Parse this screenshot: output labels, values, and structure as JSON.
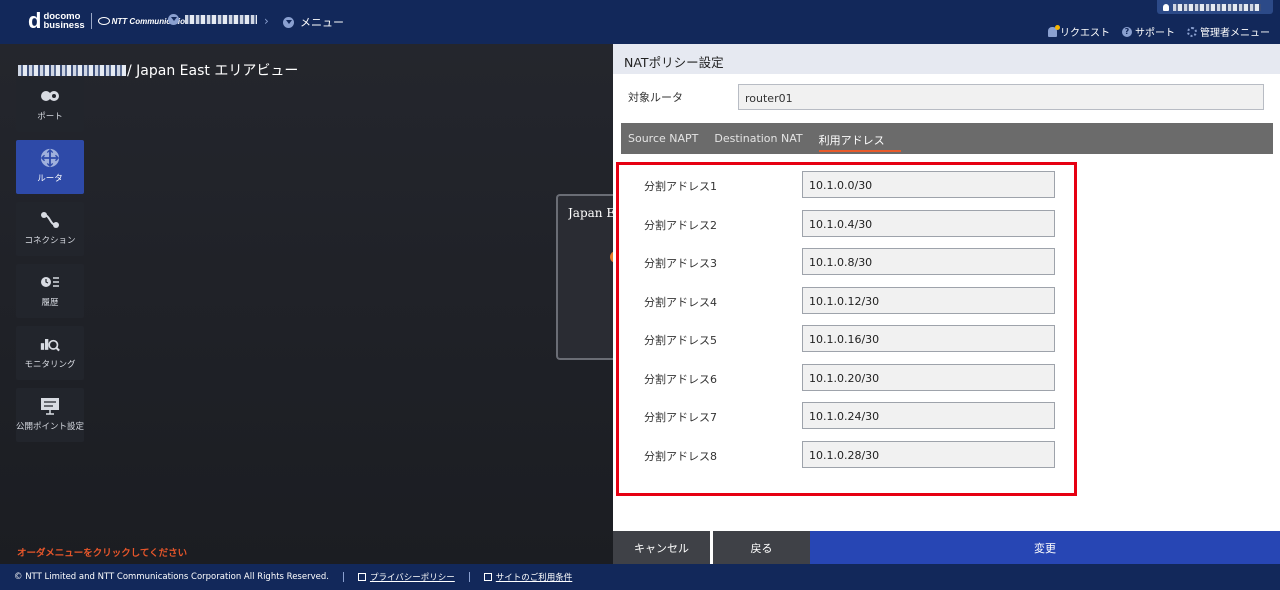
{
  "header": {
    "logo_main": "docomo",
    "logo_sub": "business",
    "ntt_logo": "NTT Communications",
    "breadcrumb_menu": "メニュー",
    "links": [
      {
        "label": "リクエスト",
        "icon": "bell-icon"
      },
      {
        "label": "サポート",
        "icon": "help-icon"
      },
      {
        "label": "管理者メニュー",
        "icon": "gear-icon"
      }
    ]
  },
  "area": {
    "title_suffix": "/ Japan East エリアビュー",
    "map_card_label": "Japan East",
    "order_hint": "オーダメニューをクリックしてください"
  },
  "sidenav": {
    "items": [
      {
        "label": "ポート",
        "icon": "port-icon",
        "active": false
      },
      {
        "label": "ルータ",
        "icon": "router-icon",
        "active": true
      },
      {
        "label": "コネクション",
        "icon": "connection-icon",
        "active": false
      },
      {
        "label": "履歴",
        "icon": "history-icon",
        "active": false
      },
      {
        "label": "モニタリング",
        "icon": "monitoring-icon",
        "active": false
      },
      {
        "label": "公開ポイント設定",
        "icon": "public-point-icon",
        "active": false
      }
    ]
  },
  "panel": {
    "title": "NATポリシー設定",
    "target_label": "対象ルータ",
    "target_value": "router01",
    "tabs": [
      "Source NAPT",
      "Destination NAT",
      "利用アドレス"
    ],
    "active_tab": "利用アドレス",
    "split_addresses": [
      {
        "label": "分割アドレス1",
        "value": "10.1.0.0/30"
      },
      {
        "label": "分割アドレス2",
        "value": "10.1.0.4/30"
      },
      {
        "label": "分割アドレス3",
        "value": "10.1.0.8/30"
      },
      {
        "label": "分割アドレス4",
        "value": "10.1.0.12/30"
      },
      {
        "label": "分割アドレス5",
        "value": "10.1.0.16/30"
      },
      {
        "label": "分割アドレス6",
        "value": "10.1.0.20/30"
      },
      {
        "label": "分割アドレス7",
        "value": "10.1.0.24/30"
      },
      {
        "label": "分割アドレス8",
        "value": "10.1.0.28/30"
      }
    ],
    "buttons": {
      "cancel": "キャンセル",
      "back": "戻る",
      "change": "変更"
    }
  },
  "footer": {
    "copyright": "© NTT Limited and NTT Communications Corporation All Rights Reserved.",
    "privacy": "プライバシーポリシー",
    "terms": "サイトのご利用条件"
  },
  "colors": {
    "brand_navy": "#12285a",
    "active_blue": "#2e4aa8",
    "highlight_red": "#e60012",
    "accent_orange": "#e85a2a"
  }
}
